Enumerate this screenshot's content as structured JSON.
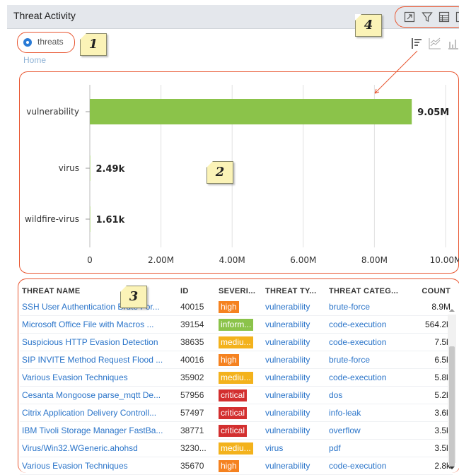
{
  "panel": {
    "title": "Threat Activity"
  },
  "toolbar": {
    "icons": [
      "expand-icon",
      "filter-icon",
      "table-icon",
      "export-icon"
    ]
  },
  "filter": {
    "label": "threats",
    "breadcrumb": "Home"
  },
  "chart_view_icons": [
    "bar-chart-icon",
    "line-chart-icon",
    "column-chart-icon"
  ],
  "callouts": [
    "1",
    "2",
    "3",
    "4"
  ],
  "colors": {
    "accent": "#2a7bd6",
    "bar": "#8bc34a",
    "highlight": "#e8552f",
    "high": "#f58220",
    "informational": "#8bc34a",
    "medium": "#f3b21c",
    "critical": "#d32f2f"
  },
  "chart_data": {
    "type": "bar",
    "orientation": "horizontal",
    "categories": [
      "vulnerability",
      "virus",
      "wildfire-virus"
    ],
    "values": [
      9050000,
      2490,
      1610
    ],
    "value_labels": [
      "9.05M",
      "2.49k",
      "1.61k"
    ],
    "xlim": [
      0,
      10000000
    ],
    "x_ticks": [
      "0",
      "2.00M",
      "4.00M",
      "6.00M",
      "8.00M",
      "10.00M"
    ],
    "grid": true
  },
  "table": {
    "columns": [
      "THREAT NAME",
      "ID",
      "SEVERI...",
      "THREAT TY...",
      "THREAT CATEG...",
      "COUNT"
    ],
    "rows": [
      {
        "name": "SSH User Authentication Brute For...",
        "id": "40015",
        "severity": "high",
        "type": "vulnerability",
        "category": "brute-force",
        "count": "8.9M"
      },
      {
        "name": "Microsoft Office File with Macros ...",
        "id": "39154",
        "severity": "inform...",
        "type": "vulnerability",
        "category": "code-execution",
        "count": "564.2k"
      },
      {
        "name": "Suspicious HTTP Evasion Detection",
        "id": "38635",
        "severity": "mediu...",
        "type": "vulnerability",
        "category": "code-execution",
        "count": "7.5k"
      },
      {
        "name": "SIP INVITE Method Request Flood ...",
        "id": "40016",
        "severity": "high",
        "type": "vulnerability",
        "category": "brute-force",
        "count": "6.5k"
      },
      {
        "name": "Various Evasion Techniques",
        "id": "35902",
        "severity": "mediu...",
        "type": "vulnerability",
        "category": "code-execution",
        "count": "5.8k"
      },
      {
        "name": "Cesanta Mongoose parse_mqtt De...",
        "id": "57956",
        "severity": "critical",
        "type": "vulnerability",
        "category": "dos",
        "count": "5.2k"
      },
      {
        "name": "Citrix Application Delivery Controll...",
        "id": "57497",
        "severity": "critical",
        "type": "vulnerability",
        "category": "info-leak",
        "count": "3.6k"
      },
      {
        "name": "IBM Tivoli Storage Manager FastBa...",
        "id": "38771",
        "severity": "critical",
        "type": "vulnerability",
        "category": "overflow",
        "count": "3.5k"
      },
      {
        "name": "Virus/Win32.WGeneric.ahohsd",
        "id": "3230...",
        "severity": "mediu...",
        "type": "virus",
        "category": "pdf",
        "count": "3.5k"
      },
      {
        "name": "Various Evasion Techniques",
        "id": "35670",
        "severity": "high",
        "type": "vulnerability",
        "category": "code-execution",
        "count": "2.8k"
      }
    ]
  }
}
